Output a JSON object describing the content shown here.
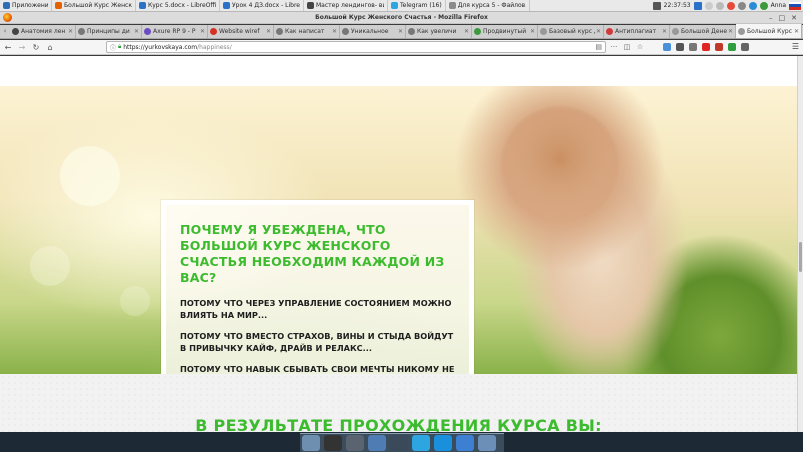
{
  "os_taskbar": {
    "tasks": [
      {
        "label": "Приложения",
        "color": "#2d6fb5"
      },
      {
        "label": "Большой Курс Женско...",
        "color": "#e66000"
      },
      {
        "label": "Курс 5.docx - LibreOffic...",
        "color": "#2a72c7"
      },
      {
        "label": "Урок 4 ДЗ.docx - LibreO...",
        "color": "#2a72c7"
      },
      {
        "label": "Мастер лендингов- ви...",
        "color": "#444444"
      },
      {
        "label": "Telegram (16)",
        "color": "#2ca5e0"
      },
      {
        "label": "Для курса 5 - Файлов...",
        "color": "#8a8a8a"
      }
    ],
    "clock": "22:37:53",
    "user": "Anna"
  },
  "window": {
    "title": "Большой Курс Женского Счастья - Mozilla Firefox",
    "min_icon": "minimize-icon",
    "max_icon": "maximize-icon",
    "close_icon": "close-icon"
  },
  "tabs": [
    {
      "label": "Анатомия лен",
      "color": "#444444",
      "active": false
    },
    {
      "label": "Принципы ди",
      "color": "#777777",
      "active": false
    },
    {
      "label": "Axure RP 9 - P",
      "color": "#6b4cc2",
      "active": false
    },
    {
      "label": "Website wiref",
      "color": "#d93025",
      "active": false
    },
    {
      "label": "Как написат",
      "color": "#777777",
      "active": false
    },
    {
      "label": "Уникальное",
      "color": "#777777",
      "active": false
    },
    {
      "label": "Как увеличи",
      "color": "#777777",
      "active": false
    },
    {
      "label": "Продвинутый",
      "color": "#3c9a3c",
      "active": false
    },
    {
      "label": "Базовый курс д",
      "color": "#999999",
      "active": false
    },
    {
      "label": "Антиплагиат",
      "color": "#d23a3a",
      "active": false
    },
    {
      "label": "Большой Денеж",
      "color": "#999999",
      "active": false
    },
    {
      "label": "Большой Курс Ж",
      "color": "#999999",
      "active": true
    }
  ],
  "navbar": {
    "url_host": "https://yurkovskaya.com",
    "url_path": "/happiness/",
    "extension_colors": [
      "#4a90d9",
      "#555555",
      "#777777",
      "#e02424",
      "#c0392b",
      "#2e9e3f",
      "#666666"
    ]
  },
  "hero": {
    "title": "ПОЧЕМУ Я УБЕЖДЕНА, ЧТО БОЛЬШОЙ КУРС ЖЕНСКОГО СЧАСТЬЯ НЕОБХОДИМ КАЖДОЙ ИЗ ВАС?",
    "paragraphs": [
      "ПОТОМУ ЧТО ЧЕРЕЗ УПРАВЛЕНИЕ СОСТОЯНИЕМ МОЖНО ВЛИЯТЬ НА МИР...",
      "ПОТОМУ ЧТО ВМЕСТО СТРАХОВ, ВИНЫ И СТЫДА ВОЙДУТ В ПРИВЫЧКУ КАЙФ, ДРАЙВ И РЕЛАКС...",
      "ПОТОМУ ЧТО НАВЫК СБЫВАТЬ СВОИ МЕЧТЫ НИКОМУ НЕ ПОМЕШАЕТ, ВЕРНО ;)?.."
    ],
    "accent_color": "#3dbb2f"
  },
  "section2": {
    "title": "В РЕЗУЛЬТАТЕ ПРОХОЖДЕНИЯ КУРСА ВЫ:"
  },
  "dock": {
    "items": [
      {
        "icon": "files-icon",
        "color": "#6f8fb0"
      },
      {
        "icon": "terminal-icon",
        "color": "#333333"
      },
      {
        "icon": "monitor-icon",
        "color": "#5a6470"
      },
      {
        "icon": "browser-globe-icon",
        "color": "#4f7db3"
      },
      {
        "icon": "search-icon",
        "color": "#3a4a5a"
      },
      {
        "icon": "telegram-icon",
        "color": "#2ca5e0"
      },
      {
        "icon": "skype-icon",
        "color": "#1a8fdb"
      },
      {
        "icon": "document-icon",
        "color": "#3d7fd1"
      },
      {
        "icon": "folder-icon",
        "color": "#6c8fb8"
      }
    ]
  }
}
